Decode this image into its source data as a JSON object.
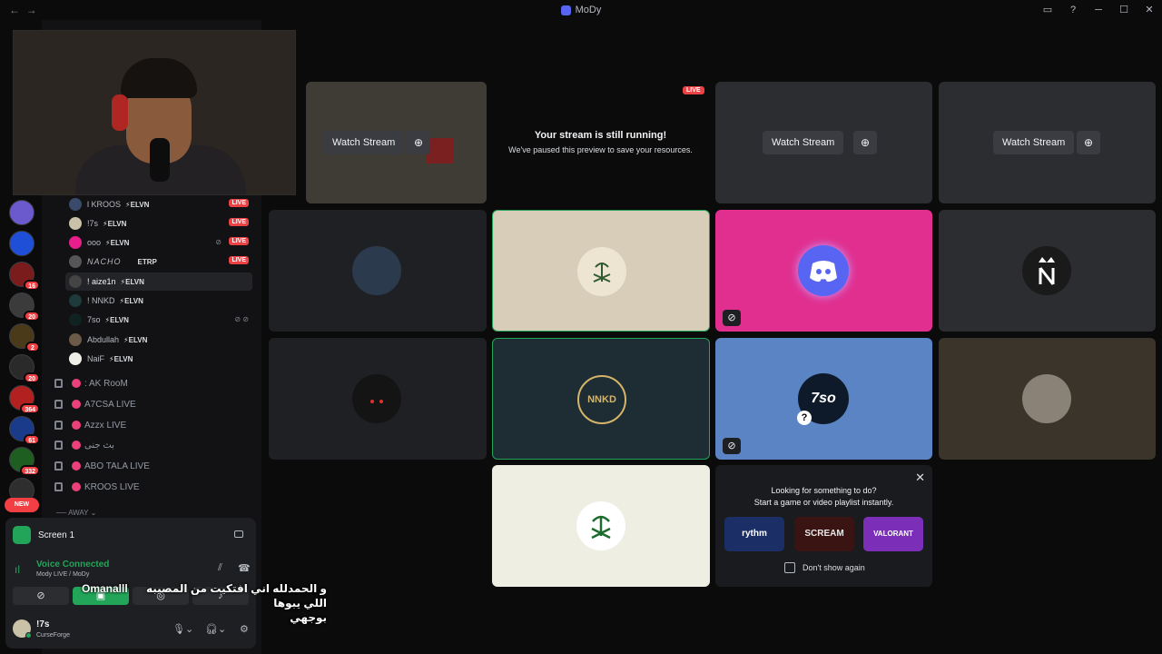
{
  "window": {
    "title": "MoDy",
    "back": "←",
    "forward": "→",
    "controls": [
      "▭",
      "?",
      "─",
      "☐",
      "✕"
    ]
  },
  "guilds": [
    {
      "badge": ""
    },
    {
      "badge": ""
    },
    {
      "badge": "16"
    },
    {
      "badge": "20"
    },
    {
      "badge": "2"
    },
    {
      "badge": "20"
    },
    {
      "badge": "364"
    },
    {
      "badge": "61"
    },
    {
      "badge": "332"
    },
    {
      "badge": ""
    }
  ],
  "new_badge": "NEW",
  "members": [
    {
      "name": "l KROOS",
      "tag": "⚡ELVN",
      "live": "LIVE"
    },
    {
      "name": "!7s",
      "tag": "⚡ELVN",
      "live": "LIVE"
    },
    {
      "name": "ooo",
      "tag": "⚡ELVN",
      "live": "LIVE"
    },
    {
      "name": "NACHO",
      "tag": "ETRP",
      "live": "LIVE"
    },
    {
      "name": "! aize1n",
      "tag": "⚡ELVN",
      "live": ""
    },
    {
      "name": "! NNKD",
      "tag": "⚡ELVN",
      "live": ""
    },
    {
      "name": "7so",
      "tag": "⚡ELVN",
      "live": ""
    },
    {
      "name": "Abdullah",
      "tag": "⚡ELVN",
      "live": ""
    },
    {
      "name": "NaiF",
      "tag": "⚡ELVN",
      "live": ""
    }
  ],
  "channels": [
    {
      "name": ": AK RooM"
    },
    {
      "name": "A7CSA LIVE"
    },
    {
      "name": "Azzx LIVE"
    },
    {
      "name": "بث جنى"
    },
    {
      "name": "ABO TALA LIVE"
    },
    {
      "name": "KROOS LIVE"
    }
  ],
  "away_label": "AWAY",
  "screen": {
    "label": "Screen 1"
  },
  "voice": {
    "status": "Voice Connected",
    "location": "Mody LIVE / MoDy"
  },
  "user": {
    "name": "!7s",
    "status": "CurseForge"
  },
  "caption": {
    "line1": "و الحمدلله اني افتكيت من المصيبه اللي يبوها",
    "line2": "بوجهي",
    "highlight": "Omanalll"
  },
  "stream": {
    "watch_label": "Watch Stream",
    "live_badge": "LIVE",
    "paused_title": "Your stream is still running!",
    "paused_sub": "We've paused this preview to save your resources."
  },
  "tiles": {
    "nnkd_label": "NNKD",
    "so_label": "7so"
  },
  "suggest": {
    "line1": "Looking for something to do?",
    "line2": "Start a game or video playlist instantly.",
    "activities": [
      "rythm",
      "SCREAM",
      "VALORANT"
    ],
    "dont_show": "Don't show again",
    "close": "✕"
  },
  "colors": {
    "accent_green": "#23a559",
    "live_red": "#ed4245",
    "discord_pink": "#e91e8c",
    "blue_tile": "#5b84c4"
  }
}
